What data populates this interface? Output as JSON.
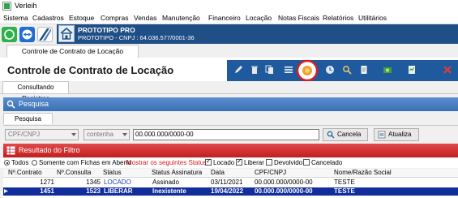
{
  "window": {
    "title": "Verleih"
  },
  "menu": [
    "Sistema",
    "Cadastros",
    "Estoque",
    "Compras",
    "Vendas",
    "Manutenção",
    "Financeiro",
    "Locação",
    "Notas Fiscais",
    "Relatórios",
    "Utilitários"
  ],
  "company": {
    "name": "PROTOTIPO PRO",
    "cnpj_line": "PROTOTIPO - CNPJ : 64.036.577/0001-36"
  },
  "main_tab": "Controle de Contrato de Locação",
  "screen_title": "Controle de Contrato de Locação",
  "subtab": "Consultando Registros",
  "pesquisa": {
    "title": "Pesquisa",
    "tab": "Pesquisa Simples",
    "field": "CPF/CNPJ",
    "operator": "contenha",
    "value": "00.000.000/0000-00",
    "cancel_label": "Cancela",
    "refresh_label": "Atualiza"
  },
  "resultado": {
    "title": "Resultado do Filtro",
    "filter": {
      "todos": "Todos",
      "somente": "Somente com Fichas em Aberto",
      "mostrar": "Mostrar os seguintes Status :",
      "locado": "Locado",
      "liberar": "Liberar",
      "devolvido": "Devolvido",
      "cancelado": "Cancelado",
      "selected_radio": "Todos",
      "checked": {
        "locado": true,
        "liberar": true,
        "devolvido": false,
        "cancelado": false
      }
    },
    "columns": [
      "Nº.Contrato",
      "Nº.Consulta",
      "Status",
      "Status Assinatura",
      "Data",
      "CPF/CNPJ",
      "Nome/Razão Social"
    ],
    "rows": [
      {
        "contrato": "1271",
        "consulta": "1345",
        "status": "LOCADO",
        "assinatura": "Assinado",
        "data": "03/11/2021",
        "cpf": "00.000.000/0000-00",
        "nome": "TESTE",
        "selected": false
      },
      {
        "contrato": "1451",
        "consulta": "1523",
        "status": "LIBERAR",
        "assinatura": "Inexistente",
        "data": "19/04/2022",
        "cpf": "00.000.000/0000-00",
        "nome": "TESTE",
        "selected": true
      }
    ]
  },
  "colors": {
    "banner": "#1f4f86",
    "action_bar": "#1f5a9e",
    "pesquisa_bar": "#3a6fb4",
    "resultado_bar": "#c21e1e",
    "selected_row": "#122e9c",
    "highlight_circle": "#e01b1b"
  },
  "icons": [
    "app-icon",
    "whatsapp-icon",
    "teamviewer-icon",
    "anydesk-icon",
    "home-icon",
    "pencil-icon",
    "trash-icon",
    "copy-icon",
    "menu-icon",
    "record-icon",
    "clock-icon",
    "search-icon",
    "document-icon",
    "money-icon",
    "report-icon",
    "close-icon"
  ]
}
